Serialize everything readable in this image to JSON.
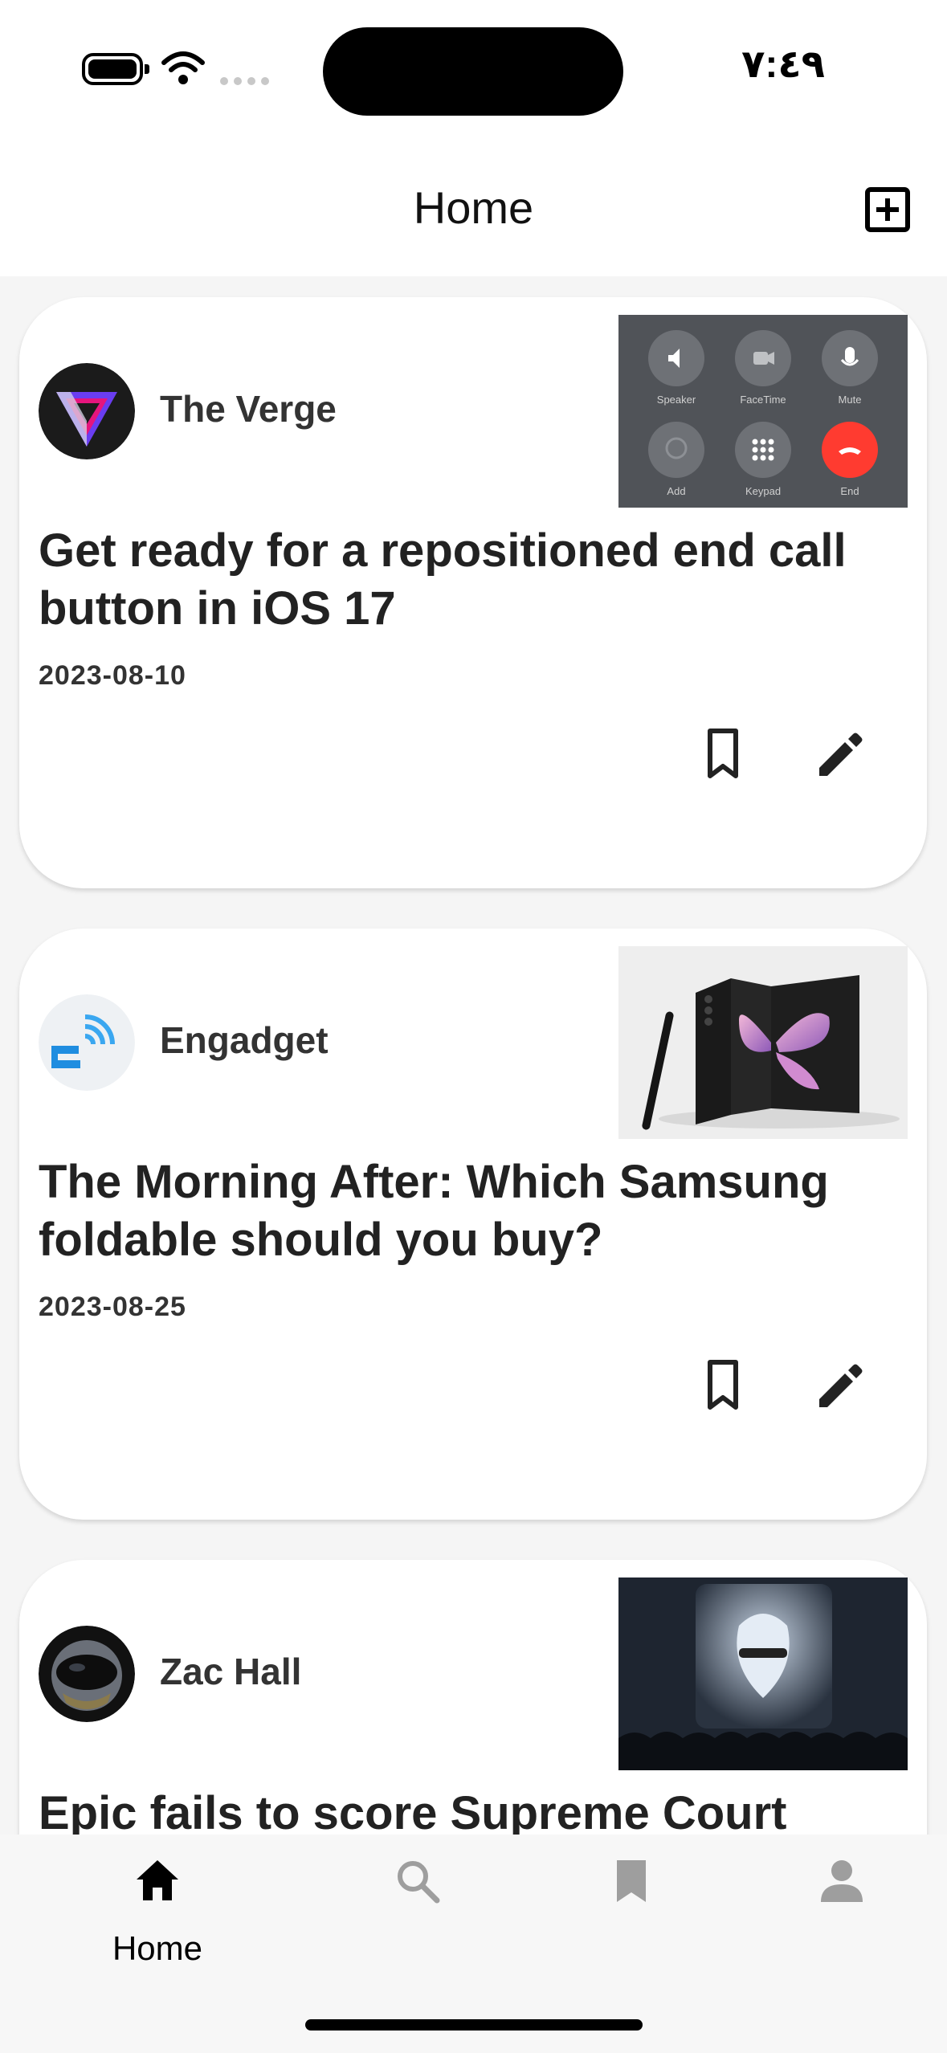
{
  "status_bar": {
    "time": "٧:٤٩"
  },
  "nav": {
    "title": "Home",
    "add_icon": "add-box-icon"
  },
  "articles": [
    {
      "source": "The Verge",
      "title": "Get ready for a repositioned end call button in iOS 17",
      "date": "2023-08-10",
      "thumb_labels": [
        "Speaker",
        "FaceTime",
        "Mute",
        "Add",
        "Keypad",
        "End"
      ]
    },
    {
      "source": "Engadget",
      "title": "The Morning After: Which Samsung foldable should you buy?",
      "date": "2023-08-25"
    },
    {
      "source": "Zac Hall",
      "title": "Epic fails to score Supreme Court",
      "date": ""
    }
  ],
  "tab_bar": {
    "home_label": "Home"
  },
  "colors": {
    "end_call": "#ff3b30",
    "accent": "#000000"
  }
}
